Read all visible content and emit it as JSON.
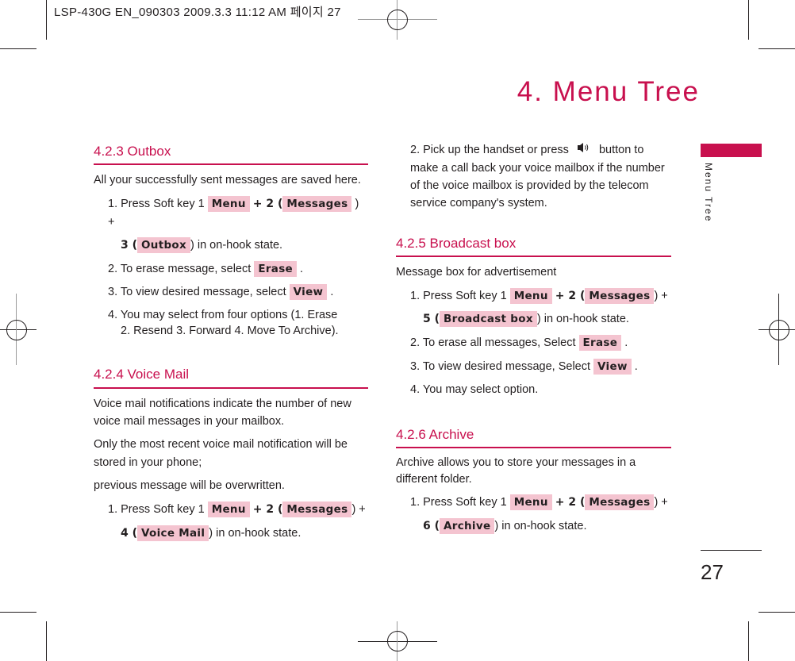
{
  "header": {
    "slug": "LSP-430G EN_090303  2009.3.3 11:12 AM  페이지 27"
  },
  "page_title": "4. Menu Tree",
  "side_tab": {
    "label": "Menu Tree",
    "color": "#c8104e"
  },
  "page_number": "27",
  "colors": {
    "accent": "#c8104e",
    "pill": "#f4c4d0",
    "text": "#231f20"
  },
  "sections": {
    "outbox": {
      "title": "4.2.3 Outbox",
      "intro": "All your successfully sent messages are saved here.",
      "step1": {
        "prefix": "1. Press Soft key 1",
        "menu": "Menu",
        "plus_2": "+ 2 (",
        "messages": "Messages",
        "close_plus": ") +",
        "num": "3 (",
        "target": "Outbox",
        "suffix": ") in on-hook state."
      },
      "step2": {
        "text": "2. To erase message, select",
        "pill": "Erase",
        "end": "."
      },
      "step3": {
        "text": "3. To view desired message, select",
        "pill": "View",
        "end": "."
      },
      "step4": {
        "line1": "4. You may select from four options (1. Erase",
        "line2": "2. Resend  3. Forward  4. Move To Archive)."
      }
    },
    "voice_mail": {
      "title": "4.2.4 Voice Mail",
      "para1": "Voice mail notifications indicate the number of new voice mail messages in your mailbox.",
      "para2": "Only the most recent voice mail notification will be stored in your phone;",
      "para3": "previous message will be overwritten.",
      "step1": {
        "prefix": "1. Press Soft key 1",
        "menu": "Menu",
        "plus_2": "+ 2 (",
        "messages": "Messages",
        "close_plus": ") +",
        "num": "4 (",
        "target": "Voice Mail",
        "suffix": ") in on-hook state."
      },
      "step2": {
        "before_icon": "2. Pick up the handset or press",
        "icon": "speaker-icon",
        "after_icon": "button to make a call back your voice mailbox if the number of the voice mailbox is provided by the telecom service company's system."
      }
    },
    "broadcast": {
      "title": "4.2.5 Broadcast box",
      "intro": "Message box for advertisement",
      "step1": {
        "prefix": "1. Press Soft key 1",
        "menu": "Menu",
        "plus_2": "+ 2 (",
        "messages": "Messages",
        "close_plus": ") +",
        "num": "5 (",
        "target": "Broadcast box",
        "suffix": ") in on-hook state."
      },
      "step2": {
        "text": "2. To erase all messages, Select",
        "pill": "Erase",
        "end": "."
      },
      "step3": {
        "text": "3. To view desired message, Select",
        "pill": "View",
        "end": "."
      },
      "step4": {
        "text": "4. You may select option."
      }
    },
    "archive": {
      "title": "4.2.6 Archive",
      "intro": "Archive allows you to store your messages in a different folder.",
      "step1": {
        "prefix": "1. Press Soft key 1",
        "menu": "Menu",
        "plus_2": "+ 2 (",
        "messages": "Messages",
        "close_plus": ") +",
        "num": "6 (",
        "target": "Archive",
        "suffix": ") in on-hook state."
      }
    }
  }
}
